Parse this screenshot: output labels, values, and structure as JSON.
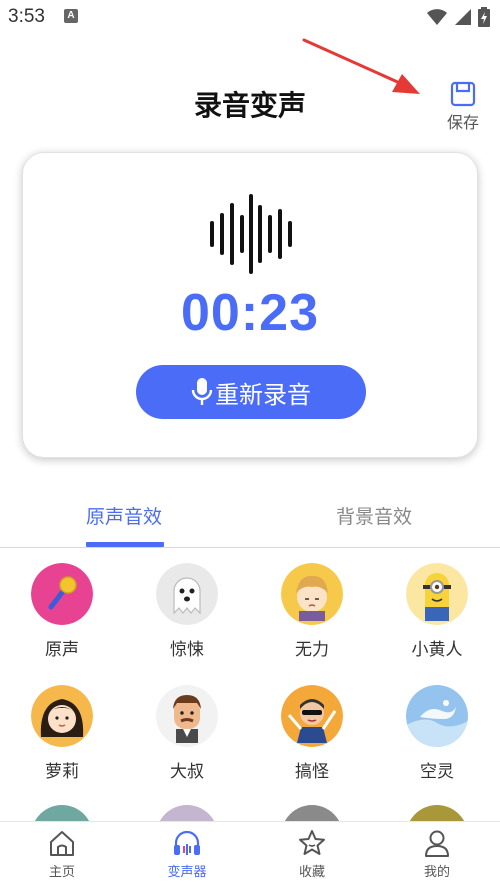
{
  "status_bar": {
    "time": "3:53",
    "app_icon_letter": "A"
  },
  "header": {
    "title": "录音变声",
    "save_label": "保存"
  },
  "recorder": {
    "timer": "00:23",
    "rerecord_label": "重新录音",
    "accent_color": "#4a6cf7"
  },
  "tabs": [
    {
      "label": "原声音效",
      "active": true
    },
    {
      "label": "背景音效",
      "active": false
    }
  ],
  "effects": [
    {
      "label": "原声",
      "icon": "microphone-avatar"
    },
    {
      "label": "惊悚",
      "icon": "ghost-avatar"
    },
    {
      "label": "无力",
      "icon": "tired-boy-avatar"
    },
    {
      "label": "小黄人",
      "icon": "minion-avatar"
    },
    {
      "label": "萝莉",
      "icon": "girl-avatar"
    },
    {
      "label": "大叔",
      "icon": "uncle-avatar"
    },
    {
      "label": "搞怪",
      "icon": "funny-avatar"
    },
    {
      "label": "空灵",
      "icon": "ethereal-avatar"
    }
  ],
  "bottom_nav": [
    {
      "label": "主页",
      "icon": "home-icon",
      "active": false
    },
    {
      "label": "变声器",
      "icon": "headphones-icon",
      "active": true
    },
    {
      "label": "收藏",
      "icon": "star-icon",
      "active": false
    },
    {
      "label": "我的",
      "icon": "user-icon",
      "active": false
    }
  ]
}
